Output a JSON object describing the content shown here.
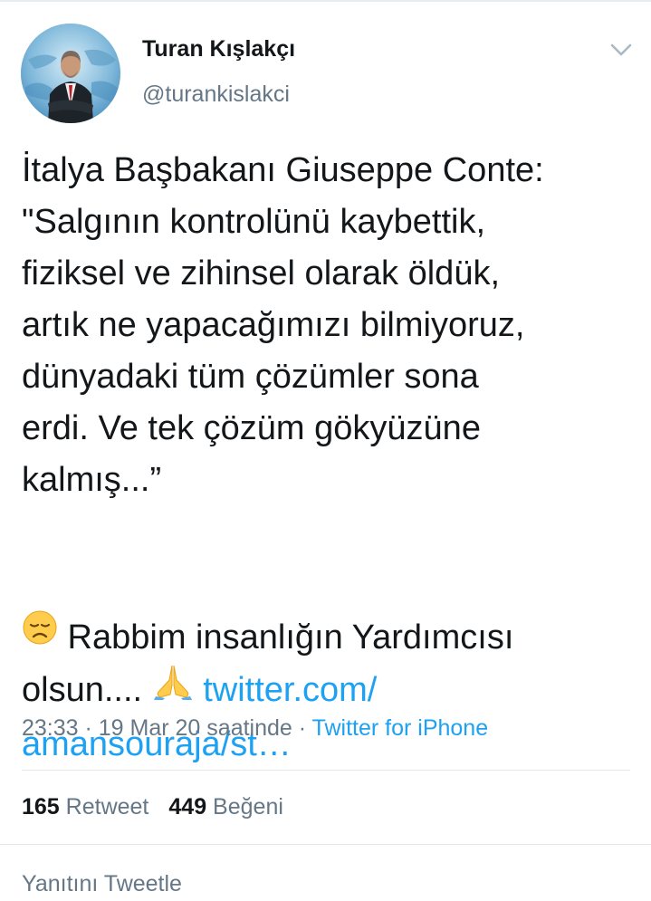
{
  "author": {
    "display_name": "Turan Kışlakçı",
    "handle": "@turankislakci"
  },
  "tweet": {
    "lines": [
      "İtalya Başbakanı Giuseppe Conte:",
      "\"Salgının kontrolünü kaybettik,",
      "fiziksel ve zihinsel olarak öldük,",
      "artık ne yapacağımızı bilmiyoruz,",
      "dünyadaki tüm çözümler sona",
      "erdi. Ve tek çözüm gökyüzüne",
      "kalmış...”"
    ],
    "line8_text": " Rabbim insanlığın Yardımcısı",
    "line9_text": "olsun.... ",
    "link_part1": "twitter.com/",
    "link_part2": "amansouraja/st…",
    "emoji_disappointed": "disappointed-face-icon",
    "emoji_pray": "folded-hands-icon"
  },
  "meta": {
    "time": "23:33 · 19 Mar 20 saatinde · ",
    "source": "Twitter for iPhone"
  },
  "stats": {
    "retweet_count": "165",
    "retweet_label": " Retweet",
    "like_count": "449",
    "like_label": " Beğeni"
  },
  "reply": {
    "label": "Yanıtını Tweetle"
  },
  "colors": {
    "accent": "#1da1f2",
    "secondary_text": "#657786",
    "primary_text": "#14171a"
  }
}
